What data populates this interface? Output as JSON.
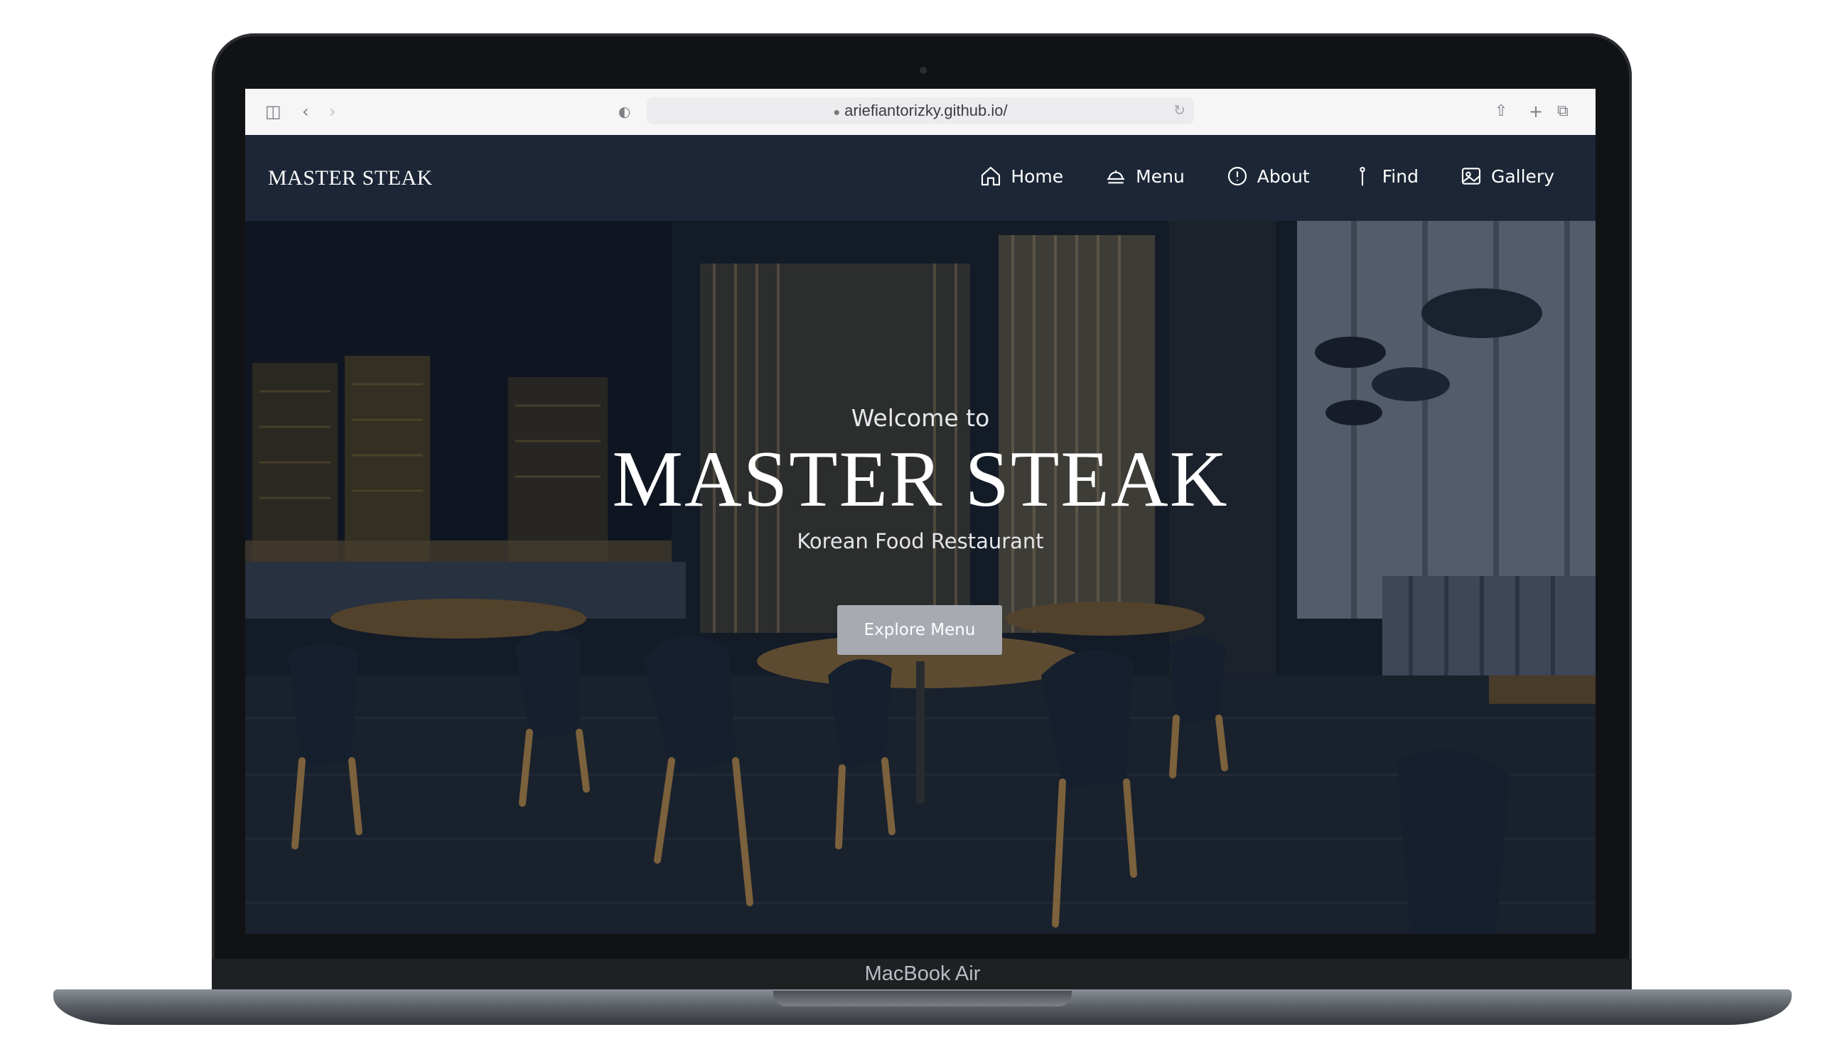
{
  "device": {
    "label": "MacBook Air"
  },
  "browser": {
    "url": "ariefiantorizky.github.io/"
  },
  "site": {
    "logo": "MASTER STEAK",
    "nav": [
      {
        "label": "Home",
        "icon": "home-icon"
      },
      {
        "label": "Menu",
        "icon": "menu-food-icon"
      },
      {
        "label": "About",
        "icon": "info-icon"
      },
      {
        "label": "Find",
        "icon": "location-pin-icon"
      },
      {
        "label": "Gallery",
        "icon": "gallery-icon"
      }
    ]
  },
  "hero": {
    "welcome": "Welcome to",
    "title": "MASTER STEAK",
    "subtitle": "Korean Food Restaurant",
    "button_label": "Explore Menu"
  },
  "colors": {
    "nav_background": "#1c2636",
    "button_background": "#a8aab2"
  }
}
